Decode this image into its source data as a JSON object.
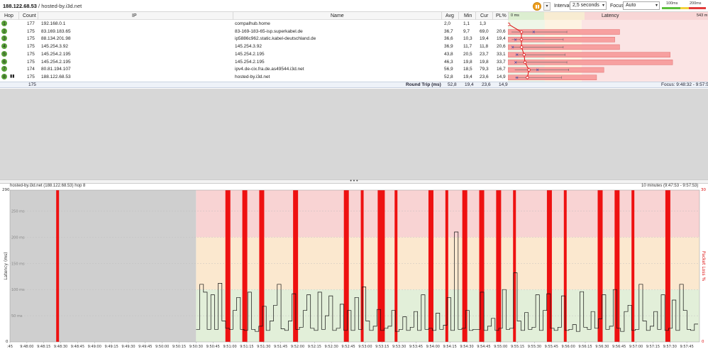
{
  "toolbar": {
    "host_ip": "188.122.68.53",
    "host_sep": " / ",
    "host_name": "hosted-by.i3d.net",
    "interval_label": "Interval",
    "interval_value": "2,5 seconds",
    "focus_label": "Focus",
    "focus_value": "Auto",
    "scale_100": "100ms",
    "scale_200": "200ms",
    "colors": {
      "pause": "#f0a020",
      "green": "#5bbf3a",
      "yellow": "#f2d23b",
      "red": "#e23b3b"
    }
  },
  "grid": {
    "columns": {
      "hop": "Hop",
      "count": "Count",
      "ip": "IP",
      "name": "Name",
      "avg": "Avg",
      "min": "Min",
      "cur": "Cur",
      "pl": "PL%",
      "latency": "Latency"
    },
    "rows": [
      {
        "hop": "1",
        "count": "177",
        "ip": "192.168.0.1",
        "name": "compalhub.home",
        "avg": "2,0",
        "min": "1,1",
        "cur": "1,3",
        "pl": ""
      },
      {
        "hop": "2",
        "count": "175",
        "ip": "83.169.183.65",
        "name": "83-169-183-65-isp.superkabel.de",
        "avg": "36,7",
        "min": "9,7",
        "cur": "69,0",
        "pl": "20,6"
      },
      {
        "hop": "3",
        "count": "175",
        "ip": "88.134.201.98",
        "name": "ip5886c962.static.kabel-deutschland.de",
        "avg": "36,6",
        "min": "10,3",
        "cur": "19,4",
        "pl": "19,4"
      },
      {
        "hop": "4",
        "count": "175",
        "ip": "145.254.3.92",
        "name": "145.254.3.92",
        "avg": "36,9",
        "min": "11,7",
        "cur": "11,8",
        "pl": "20,6"
      },
      {
        "hop": "5",
        "count": "175",
        "ip": "145.254.2.195",
        "name": "145.254.2.195",
        "avg": "43,8",
        "min": "20,5",
        "cur": "23,7",
        "pl": "33,1"
      },
      {
        "hop": "6",
        "count": "175",
        "ip": "145.254.2.195",
        "name": "145.254.2.195",
        "avg": "46,3",
        "min": "19,8",
        "cur": "19,8",
        "pl": "33,7"
      },
      {
        "hop": "7",
        "count": "174",
        "ip": "80.81.194.107",
        "name": "ipv4.de-cix.fra.de.as49544.i3d.net",
        "avg": "56,9",
        "min": "18,5",
        "cur": "79,3",
        "pl": "16,7"
      },
      {
        "hop": "8",
        "count": "175",
        "ip": "188.122.68.53",
        "name": "hosted-by.i3d.net",
        "avg": "52,8",
        "min": "19,4",
        "cur": "23,6",
        "pl": "14,9"
      }
    ],
    "totals": {
      "count": "175",
      "label": "Round Trip (ms)",
      "avg": "52,8",
      "min": "19,4",
      "cur": "23,6",
      "pl": "14,9",
      "focus": "Focus: 9:48:32 - 9:57:53"
    },
    "latency_header": {
      "start": "0 ms",
      "end": "543 m"
    },
    "latency_bars": [
      {
        "min": 1.1,
        "avg": 2.0,
        "max": 3.0,
        "cur": 1.3,
        "pl": 0
      },
      {
        "min": 9.7,
        "avg": 36.7,
        "max": 160,
        "cur": 69.0,
        "pl": 20.6
      },
      {
        "min": 10.3,
        "avg": 36.6,
        "max": 150,
        "cur": 19.4,
        "pl": 19.4
      },
      {
        "min": 11.7,
        "avg": 36.9,
        "max": 150,
        "cur": 11.8,
        "pl": 20.6
      },
      {
        "min": 20.5,
        "avg": 43.8,
        "max": 155,
        "cur": 23.7,
        "pl": 33.1
      },
      {
        "min": 19.8,
        "avg": 46.3,
        "max": 160,
        "cur": 19.8,
        "pl": 33.7
      },
      {
        "min": 18.5,
        "avg": 56.9,
        "max": 165,
        "cur": 79.3,
        "pl": 16.7
      },
      {
        "min": 19.4,
        "avg": 52.8,
        "max": 145,
        "cur": 23.6,
        "pl": 14.9
      }
    ]
  },
  "graph": {
    "title": "hosted-by.i3d.net (188.122.68.53) hop 8",
    "range": "10 minutes (9:47:53 - 9:57:53)",
    "ylabel_left": "Latency (ms)",
    "ylabel_right": "Packet Loss %",
    "ymax_left": "290",
    "ymin_left": "0",
    "ymax_right": "30",
    "ymin_right": "0",
    "y_ticks": [
      "250 ms",
      "200 ms",
      "150 ms",
      "100 ms",
      "50 ms"
    ],
    "x_ticks": [
      ":45",
      "9:48:00",
      "9:48:15",
      "9:48:30",
      "9:48:45",
      "9:49:00",
      "9:49:15",
      "9:49:30",
      "9:49:45",
      "9:50:00",
      "9:50:15",
      "9:50:30",
      "9:50:45",
      "9:51:00",
      "9:51:15",
      "9:51:30",
      "9:51:45",
      "9:52:00",
      "9:52:15",
      "9:52:30",
      "9:52:45",
      "9:53:00",
      "9:53:15",
      "9:53:30",
      "9:53:45",
      "9:54:00",
      "9:54:15",
      "9:54:30",
      "9:54:45",
      "9:55:00",
      "9:55:15",
      "9:55:30",
      "9:55:45",
      "9:56:00",
      "9:56:15",
      "9:56:30",
      "9:56:45",
      "9:57:00",
      "9:57:15",
      "9:57:30",
      "9:57:45"
    ],
    "chart_data": {
      "type": "line",
      "ylim": [
        0,
        290
      ],
      "packet_loss_ylim": [
        0,
        30
      ],
      "zones_ms": [
        100,
        200,
        290
      ],
      "start": "9:50:30",
      "latency_ms": [
        24,
        110,
        95,
        24,
        90,
        24,
        112,
        40,
        26,
        24,
        60,
        85,
        24,
        22,
        95,
        24,
        20,
        30,
        68,
        22,
        40,
        70,
        110,
        25,
        22,
        40,
        92,
        24,
        28,
        60,
        90,
        26,
        22,
        95,
        24,
        50,
        88,
        22,
        26,
        72,
        22,
        60,
        22,
        85,
        24,
        105,
        40,
        22,
        30,
        62,
        22,
        26,
        30,
        60,
        20,
        24,
        48,
        22,
        28,
        58,
        22,
        90,
        24,
        26,
        22,
        55,
        24,
        32,
        85,
        22,
        210,
        24,
        26,
        60,
        22,
        24,
        24,
        95,
        22,
        30,
        45,
        22,
        26,
        100,
        24,
        26,
        132,
        40,
        22,
        56,
        24,
        28,
        90,
        22,
        60,
        92,
        26,
        22,
        28,
        88,
        22,
        24,
        33,
        20,
        96,
        28,
        24,
        58,
        26,
        44,
        90,
        24,
        30,
        100,
        26,
        20,
        58,
        70,
        22,
        24,
        110,
        40,
        22,
        30,
        58,
        24,
        90,
        22,
        26,
        80,
        22,
        110,
        60,
        24,
        22,
        34
      ],
      "loss_marks": [
        {
          "at": "9:48:30",
          "w": 1
        },
        {
          "at": "9:51:00",
          "w": 2
        },
        {
          "at": "9:51:15",
          "w": 2
        },
        {
          "at": "9:51:30",
          "w": 2
        },
        {
          "at": "9:52:00",
          "w": 2
        },
        {
          "at": "9:52:45",
          "w": 2
        },
        {
          "at": "9:53:00",
          "w": 1
        },
        {
          "at": "9:53:15",
          "w": 3
        },
        {
          "at": "9:53:30",
          "w": 1
        },
        {
          "at": "9:54:00",
          "w": 2
        },
        {
          "at": "9:54:15",
          "w": 1
        },
        {
          "at": "9:54:30",
          "w": 2
        },
        {
          "at": "9:54:45",
          "w": 2
        },
        {
          "at": "9:55:00",
          "w": 2
        },
        {
          "at": "9:55:15",
          "w": 1
        },
        {
          "at": "9:55:45",
          "w": 2
        },
        {
          "at": "9:56:00",
          "w": 1
        },
        {
          "at": "9:56:30",
          "w": 2
        },
        {
          "at": "9:56:45",
          "w": 2
        },
        {
          "at": "9:57:00",
          "w": 1
        },
        {
          "at": "9:57:30",
          "w": 2
        }
      ],
      "colors": {
        "zone_low": "#e2efd9",
        "zone_mid": "#fbe8cf",
        "zone_high": "#f8d3d3",
        "loss": "#ee1111",
        "line": "#111111",
        "nodata": "#cfcfcf"
      }
    }
  }
}
